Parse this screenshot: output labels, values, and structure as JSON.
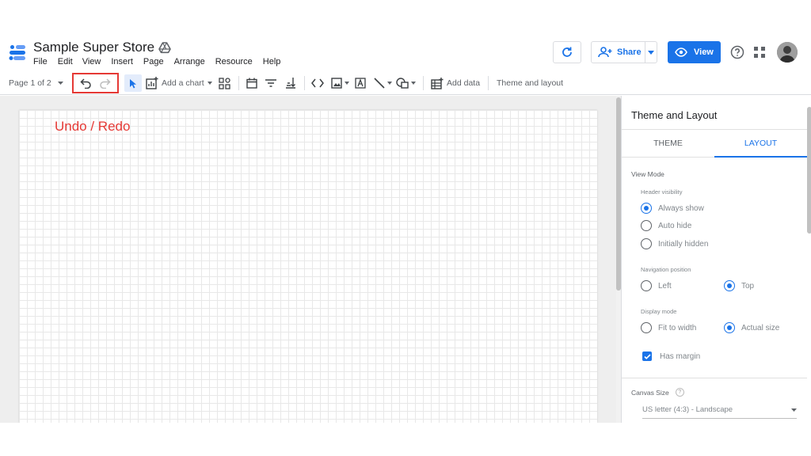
{
  "header": {
    "title": "Sample Super Store",
    "menu": [
      "File",
      "Edit",
      "View",
      "Insert",
      "Page",
      "Arrange",
      "Resource",
      "Help"
    ],
    "share_label": "Share",
    "view_label": "View",
    "icons": {
      "logo": "data-studio-logo",
      "drive": "drive-icon",
      "refresh": "refresh-icon",
      "help": "help-icon",
      "apps": "apps-grid-icon"
    }
  },
  "toolbar": {
    "page_label": "Page 1 of 2",
    "add_chart_label": "Add a chart",
    "add_data_label": "Add data",
    "theme_layout_label": "Theme and layout"
  },
  "canvas": {
    "annotation": "Undo / Redo"
  },
  "panel": {
    "title": "Theme and Layout",
    "tabs": [
      {
        "label": "THEME",
        "active": false
      },
      {
        "label": "LAYOUT",
        "active": true
      }
    ],
    "view_mode_label": "View Mode",
    "header_visibility": {
      "label": "Header visibility",
      "options": [
        "Always show",
        "Auto hide",
        "Initially hidden"
      ],
      "selected": "Always show"
    },
    "navigation_position": {
      "label": "Navigation position",
      "options": [
        "Left",
        "Top"
      ],
      "selected": "Top"
    },
    "display_mode": {
      "label": "Display mode",
      "options": [
        "Fit to width",
        "Actual size"
      ],
      "selected": "Actual size"
    },
    "has_margin_label": "Has margin",
    "has_margin_checked": true,
    "canvas_size_label": "Canvas Size",
    "canvas_size_help": "?",
    "canvas_size_value": "US letter (4:3) - Landscape"
  },
  "colors": {
    "accent": "#1a73e8",
    "annotation": "#e53935"
  }
}
